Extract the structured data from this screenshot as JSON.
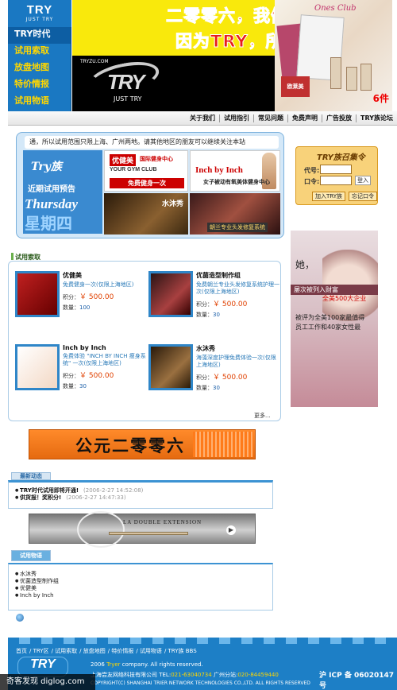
{
  "header": {
    "logo_text": "TRY",
    "logo_sub": "JUST TRY",
    "nav": [
      "TRY时代",
      "试用索取",
      "放盘地图",
      "特价情报",
      "试用物语"
    ],
    "tryzu_url": "TRYZU.COM",
    "banner_logo_word": "TRY",
    "banner_logo_sub": "JUST TRY",
    "slogan_line1": "二零零六，我们步入T时代",
    "slogan_line2": "因为TRY，所以BUY!",
    "magazine": "Ones Club",
    "sample_label": "欧莱美",
    "product_count": "6件"
  },
  "topnav": {
    "links": [
      "关于我们",
      "试用指引",
      "常见问题",
      "免费声明",
      "广告投放",
      "TRY族论坛"
    ]
  },
  "promo": {
    "marquee": "通，所以试用范围只限上海、广州两地。请其他地区的朋友可以继续关注本站",
    "trybox_logo": "Try族",
    "recent_label": "近期试用预告",
    "thursday": "Thursday",
    "xingqi": "星期四",
    "gym_badge": "优健美",
    "gym_tag": "国际健身中心",
    "gym_club": "YOUR GYM CLUB",
    "gym_free": "免费健身一次",
    "inch_title": "Inch by Inch",
    "inch_sub": "女子被动有氧美体健身中心",
    "bath_label": "水沐秀",
    "salon_label": "朝兰专业头发修复系统"
  },
  "login": {
    "title": "TRY族召集令",
    "code_label": "代号:",
    "pass_label": "口令:",
    "go_label": "登入",
    "join_label": "加入TRY族",
    "forgot_label": "忘记口令"
  },
  "trial": {
    "section_label": "试用索取",
    "price_label": "积分：",
    "qty_label": "数量：",
    "currency": "￥",
    "more_label": "更多...",
    "products": [
      {
        "name": "优健美",
        "desc": "免费健身一次(仅限上海地区)",
        "price": "500.00",
        "qty": "100",
        "img_text": "免费健身一次"
      },
      {
        "name": "优菌造型制作组",
        "desc": "免费朝兰专业头发修复系统护理一次(仅限上海地区)",
        "price": "500.00",
        "qty": "30",
        "img_text": ""
      },
      {
        "name": "Inch by Inch",
        "desc": "免费体验 \"INCH BY INCH 瘦身系统\" 一次(仅限上海地区)",
        "price": "500.00",
        "qty": "30",
        "img_text": "Inch by Inch"
      },
      {
        "name": "水沐秀",
        "desc": "海藻深度护理免费体验一次(仅限上海地区)",
        "price": "500.00",
        "qty": "30",
        "img_text": ""
      }
    ]
  },
  "right_ad": {
    "line1": "她，",
    "line2": "屡次被列入财富",
    "line3": "全美500大企业",
    "line4": "被评为全美100家最值得",
    "line5": "员工工作和40家女性最"
  },
  "banner2": {
    "text": "公元二零零六"
  },
  "news": {
    "section_label": "最新动态",
    "items": [
      {
        "title": "TRY时代试用即将开通!",
        "date": "(2006-2-27 14:52:08)"
      },
      {
        "title": "供货报！奖积分!",
        "date": "(2006-2-27 14:47:33)"
      }
    ]
  },
  "banner3": {
    "text": "LA DOUBLE EXTENSION"
  },
  "stories": {
    "section_label": "试用物语",
    "items": [
      "水沐秀",
      "优菌造型制作组",
      "优健美",
      "Inch by Inch"
    ]
  },
  "footer": {
    "links": [
      "首页",
      "TRY区",
      "试用索取",
      "放盘地图",
      "特价情报",
      "试用物语",
      "TRY族 BBS"
    ],
    "logo": "TRY",
    "copyright_pre": "2006",
    "copyright_try": "Tryer",
    "copyright_post": "company. All rights reserved.",
    "company": "上海尝友网络科技有限公司",
    "tel_label": "TEL:",
    "tel": "021-63040734",
    "gz_label": "广州分站:",
    "gz_tel": "020-84459440",
    "icp": "沪 ICP 备 06020147 号",
    "rights": "COPYRIGHT(C) SHANGHAI TRIER NETWORK TECHNOLOGIES CO.,LTD. ALL RIGHTS RESERVED"
  },
  "watermark": "奇客发现 diglog.com"
}
